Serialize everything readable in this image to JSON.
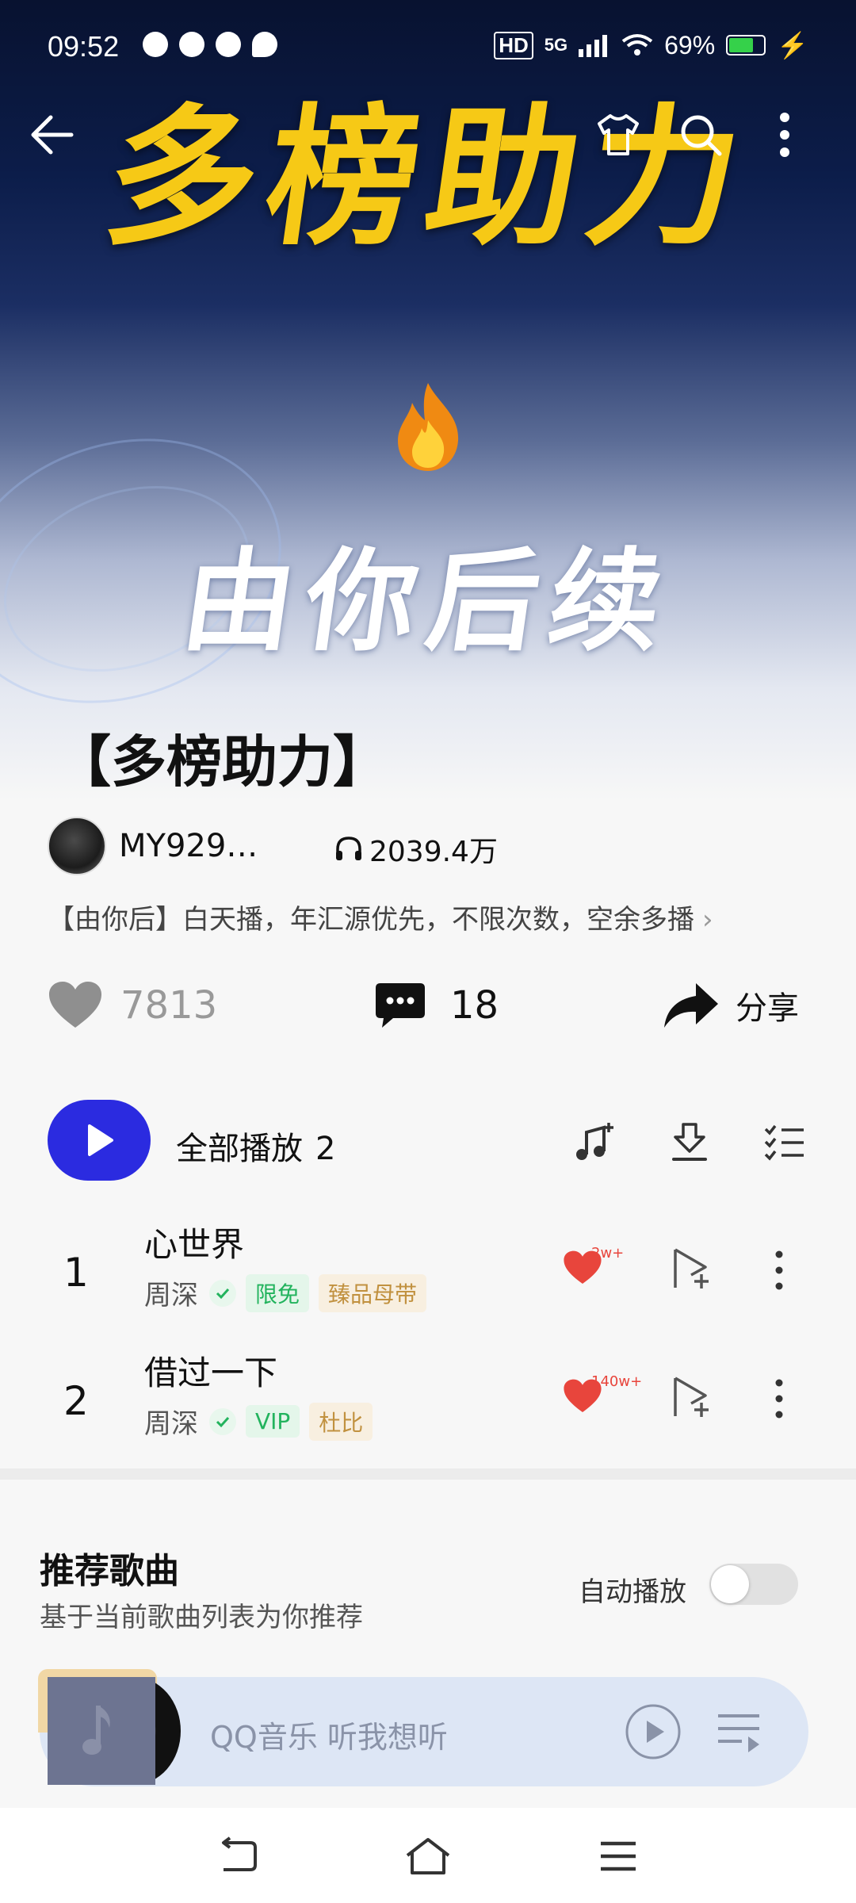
{
  "status_bar": {
    "time": "09:52",
    "battery": "69%",
    "network": "5G",
    "hd": "HD"
  },
  "hero": {
    "title_art": "多榜助力",
    "subtitle_art": "由你后续"
  },
  "playlist": {
    "title": "【多榜助力】",
    "creator": "MY929…",
    "play_count": "2039.4万",
    "description": "【由你后】白天播，年汇源优先，不限次数，空余多播",
    "likes": "7813",
    "comments": "18",
    "share_label": "分享"
  },
  "play_all": {
    "label": "全部播放",
    "count": "2"
  },
  "songs": [
    {
      "index": "1",
      "title": "心世界",
      "artist": "周深",
      "tags": [
        "限免",
        "臻品母带"
      ],
      "heart_badge": "2w+"
    },
    {
      "index": "2",
      "title": "借过一下",
      "artist": "周深",
      "tags": [
        "VIP",
        "杜比"
      ],
      "heart_badge": "140w+"
    }
  ],
  "recommend": {
    "title": "推荐歌曲",
    "subtitle": "基于当前歌曲列表为你推荐",
    "autoplay_label": "自动播放",
    "autoplay_on": false
  },
  "mini_player": {
    "text": "QQ音乐 听我想听"
  },
  "colors": {
    "accent": "#2b2be0",
    "heart": "#e8453c",
    "tag_green": "#22b35d",
    "tag_gold": "#c1913f"
  }
}
